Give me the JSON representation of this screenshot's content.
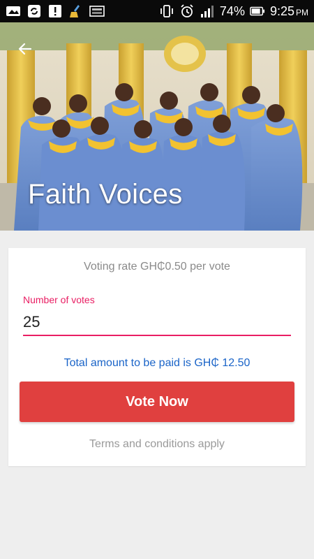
{
  "status_bar": {
    "battery_percent": "74%",
    "time": "9:25",
    "time_suffix": "PM",
    "icons": [
      "gallery-icon",
      "sync-icon",
      "alert-icon",
      "cleaner-icon",
      "image-icon",
      "vibrate-icon",
      "alarm-icon",
      "signal-icon",
      "battery-icon"
    ]
  },
  "hero": {
    "title": "Faith Voices",
    "back_icon": "back-arrow-icon"
  },
  "form": {
    "rate_text": "Voting rate GH₵0.50 per vote",
    "votes_label": "Number of votes",
    "votes_value": "25",
    "total_text": "Total amount to be paid is GH₵ 12.50",
    "vote_button": "Vote Now",
    "terms_text": "Terms and conditions apply"
  },
  "colors": {
    "accent_pink": "#e91e63",
    "button_red": "#e0403f",
    "total_blue": "#1a64c8"
  }
}
